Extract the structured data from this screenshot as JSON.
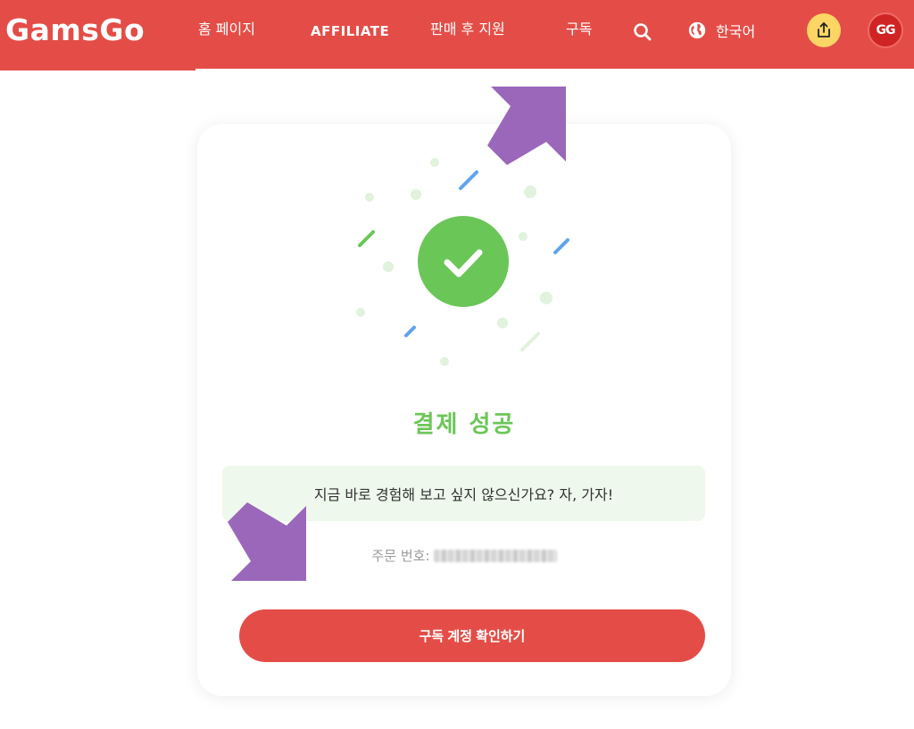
{
  "header": {
    "logo": "GamsGo",
    "nav": [
      "홈 페이지",
      "AFFILIATE",
      "판매 후 지원",
      "구독"
    ],
    "language": "한국어",
    "avatar_initials": "GG",
    "brand_color": "#e44d47"
  },
  "card": {
    "title": "결제 성공",
    "message": "지금 바로 경험해 보고 싶지 않으신가요? 자, 가자!",
    "order_label": "주문 번호:",
    "cta_label": "구독 계정 확인하기",
    "success_color": "#6bc658"
  },
  "annotations": {
    "arrow_color": "#9b67bb"
  }
}
